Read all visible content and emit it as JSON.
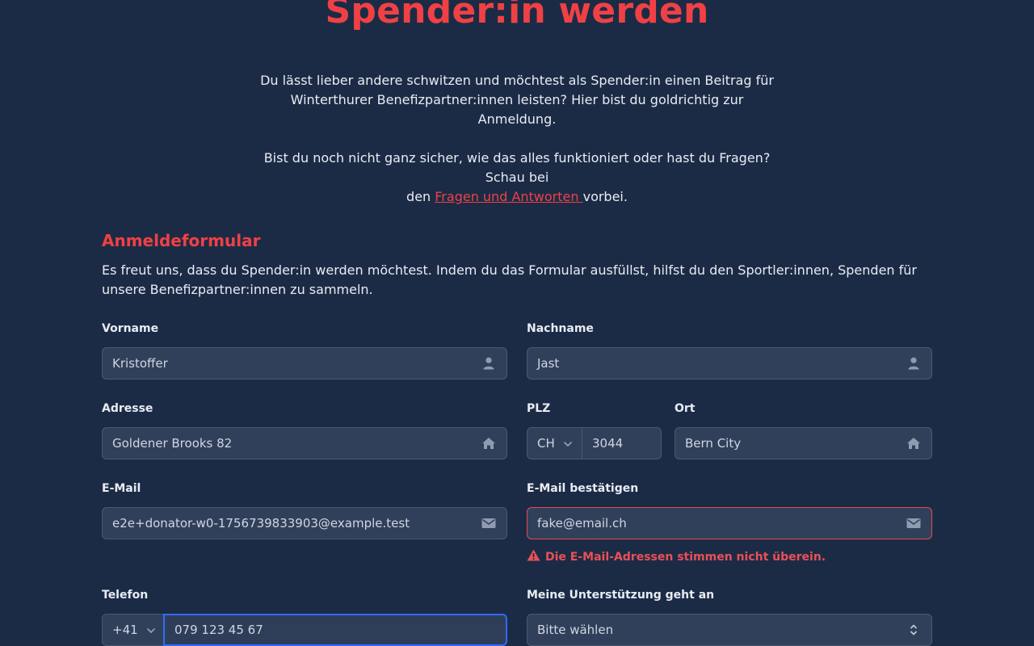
{
  "hero": {
    "title": "Spender:in werden",
    "intro_line1": "Du lässt lieber andere schwitzen und möchtest als Spender:in einen Beitrag für",
    "intro_line2": "Winterthurer Benefizpartner:innen leisten? Hier bist du goldrichtig zur Anmeldung.",
    "faq_line1": "Bist du noch nicht ganz sicher, wie das alles funktioniert oder hast du Fragen? Schau bei",
    "faq_prefix": "den ",
    "faq_link": "Fragen und Antworten ",
    "faq_suffix": "vorbei."
  },
  "form": {
    "title": "Anmeldeformular",
    "description": "Es freut uns, dass du Spender:in werden möchtest. Indem du das Formular ausfüllst, hilfst du den Sportler:innen, Spenden für unsere Benefizpartner:innen zu sammeln.",
    "firstname": {
      "label": "Vorname",
      "value": "Kristoffer",
      "icon": "user-icon"
    },
    "lastname": {
      "label": "Nachname",
      "value": "Jast",
      "icon": "user-icon"
    },
    "address": {
      "label": "Adresse",
      "value": "Goldener Brooks 82",
      "icon": "home-icon"
    },
    "zip": {
      "label": "PLZ",
      "country": "CH",
      "value": "3044"
    },
    "city": {
      "label": "Ort",
      "value": "Bern City",
      "icon": "home-icon"
    },
    "email": {
      "label": "E-Mail",
      "value": "e2e+donator-w0-1756739833903@example.test",
      "icon": "envelope-icon"
    },
    "email_confirm": {
      "label": "E-Mail bestätigen",
      "value": "fake@email.ch",
      "icon": "envelope-icon",
      "error": "Die E-Mail-Adressen stimmen nicht überein."
    },
    "phone": {
      "label": "Telefon",
      "prefix": "+41",
      "value": "079 123 45 67"
    },
    "support": {
      "label": "Meine Unterstützung geht an",
      "value": "Bitte wählen"
    }
  },
  "colors": {
    "background": "#1c2b45",
    "accent": "#ef4145",
    "error": "#e95058",
    "focus": "#2f6bff"
  }
}
